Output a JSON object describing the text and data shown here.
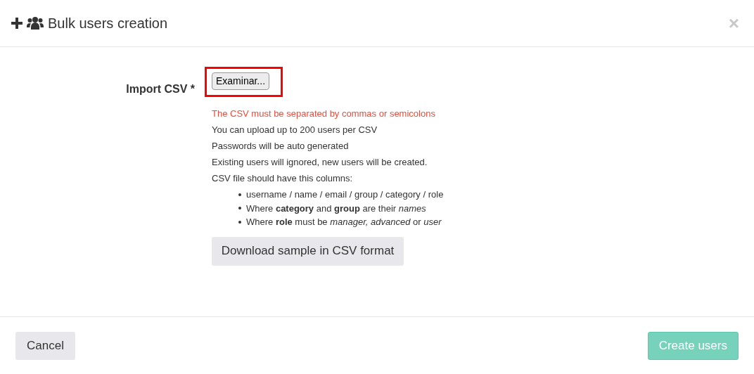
{
  "modal": {
    "title": "Bulk users creation",
    "close": "×"
  },
  "field": {
    "label": "Import CSV *",
    "file_button": "Examinar...",
    "highlighted": true
  },
  "notes": [
    {
      "text": "The CSV must be separated by commas or semicolons",
      "kind": "warning"
    },
    {
      "text": "You can upload up to 200 users per CSV",
      "kind": "info"
    },
    {
      "text": "Passwords will be auto generated",
      "kind": "info"
    },
    {
      "text": "Existing users will ignored, new users will be created.",
      "kind": "info"
    },
    {
      "text": "CSV file should have this columns:",
      "kind": "info"
    }
  ],
  "columns_list": [
    "username / name / email / group / category / role",
    "Where **category** and **group** are their *names*",
    "Where **role** must be *manager, advanced* or *user*"
  ],
  "download_button": "Download sample in CSV format",
  "footer": {
    "cancel": "Cancel",
    "submit": {
      "label": "Create users",
      "disabled": true
    }
  }
}
